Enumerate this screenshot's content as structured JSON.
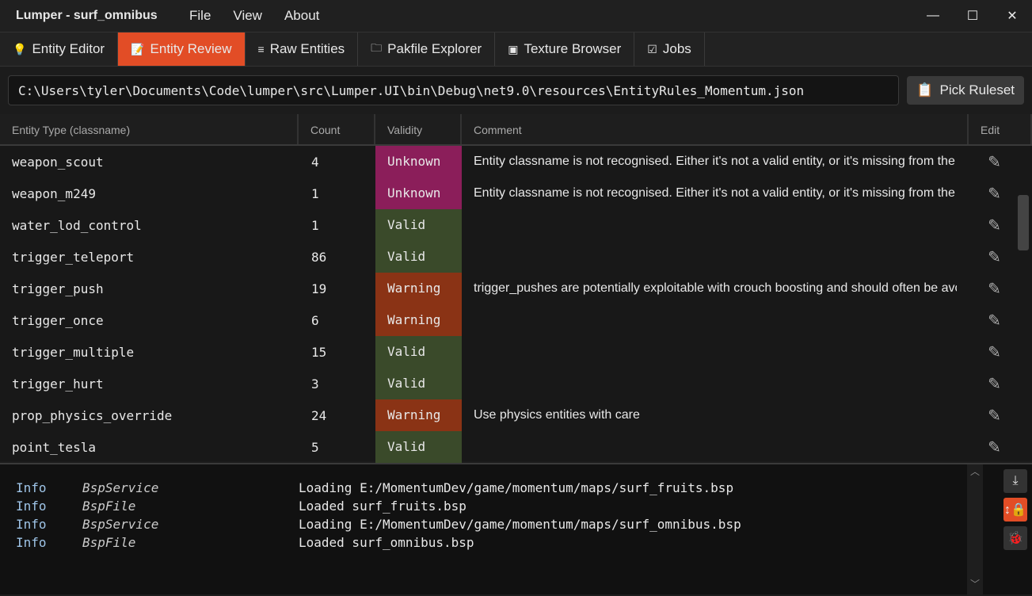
{
  "title": "Lumper - surf_omnibus",
  "menu": [
    "File",
    "View",
    "About"
  ],
  "tabs": [
    {
      "label": "Entity Editor",
      "icon": "lightbulb-icon",
      "glyph": "💡"
    },
    {
      "label": "Entity Review",
      "icon": "clipboard-edit-icon",
      "glyph": "📝"
    },
    {
      "label": "Raw Entities",
      "icon": "lines-icon",
      "glyph": "≡"
    },
    {
      "label": "Pakfile Explorer",
      "icon": "folder-zip-icon",
      "glyph": "🗀"
    },
    {
      "label": "Texture Browser",
      "icon": "images-icon",
      "glyph": "▣"
    },
    {
      "label": "Jobs",
      "icon": "checklist-icon",
      "glyph": "☑"
    }
  ],
  "path": "C:\\Users\\tyler\\Documents\\Code\\lumper\\src\\Lumper.UI\\bin\\Debug\\net9.0\\resources\\EntityRules_Momentum.json",
  "pick_label": "Pick Ruleset",
  "columns": [
    "Entity Type (classname)",
    "Count",
    "Validity",
    "Comment",
    "Edit"
  ],
  "colors": {
    "accent": "#e24d26",
    "Unknown": "#8b1e5a",
    "Valid": "#3a4a2a",
    "Warning": "#8a3315"
  },
  "rows": [
    {
      "name": "weapon_scout",
      "count": "4",
      "validity": "Unknown",
      "comment": "Entity classname is not recognised. Either it's not a valid entity, or it's missing from the ruleset."
    },
    {
      "name": "weapon_m249",
      "count": "1",
      "validity": "Unknown",
      "comment": "Entity classname is not recognised. Either it's not a valid entity, or it's missing from the ruleset."
    },
    {
      "name": "water_lod_control",
      "count": "1",
      "validity": "Valid",
      "comment": ""
    },
    {
      "name": "trigger_teleport",
      "count": "86",
      "validity": "Valid",
      "comment": ""
    },
    {
      "name": "trigger_push",
      "count": "19",
      "validity": "Warning",
      "comment": "trigger_pushes are potentially exploitable with crouch boosting and should often be avoided"
    },
    {
      "name": "trigger_once",
      "count": "6",
      "validity": "Warning",
      "comment": ""
    },
    {
      "name": "trigger_multiple",
      "count": "15",
      "validity": "Valid",
      "comment": ""
    },
    {
      "name": "trigger_hurt",
      "count": "3",
      "validity": "Valid",
      "comment": ""
    },
    {
      "name": "prop_physics_override",
      "count": "24",
      "validity": "Warning",
      "comment": "Use physics entities with care"
    },
    {
      "name": "point_tesla",
      "count": "5",
      "validity": "Valid",
      "comment": ""
    }
  ],
  "log": [
    {
      "level": "Info",
      "source": "BspService",
      "msg": "Loading E:/MomentumDev/game/momentum/maps/surf_fruits.bsp"
    },
    {
      "level": "Info",
      "source": "BspFile",
      "msg": "Loaded surf_fruits.bsp"
    },
    {
      "level": "Info",
      "source": "BspService",
      "msg": "Loading E:/MomentumDev/game/momentum/maps/surf_omnibus.bsp"
    },
    {
      "level": "Info",
      "source": "BspFile",
      "msg": "Loaded surf_omnibus.bsp"
    }
  ]
}
